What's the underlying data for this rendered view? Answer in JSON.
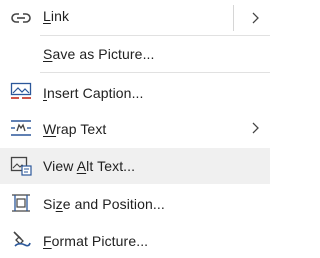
{
  "menu": {
    "items": [
      {
        "key": "L",
        "rest": "ink",
        "icon": "link-icon",
        "submenu": true
      },
      {
        "key": "S",
        "rest": "ave as Picture...",
        "icon": "",
        "submenu": false
      },
      {
        "key": "I",
        "rest": "nsert Caption...",
        "icon": "insert-caption-icon",
        "submenu": false
      },
      {
        "key": "W",
        "rest": "rap Text",
        "icon": "wrap-text-icon",
        "submenu": true
      },
      {
        "pre": "View ",
        "key": "A",
        "rest": "lt Text...",
        "icon": "alt-text-icon",
        "submenu": false
      },
      {
        "key": "",
        "pre": "Si",
        "keyMid": "z",
        "rest": "e and Position...",
        "icon": "size-position-icon",
        "submenu": false
      },
      {
        "key": "F",
        "rest": "ormat Picture...",
        "icon": "format-picture-icon",
        "submenu": false
      }
    ]
  },
  "colors": {
    "icon_blue": "#2b579a",
    "icon_red": "#c42b1c",
    "hover_bg": "#f0f0f0"
  }
}
